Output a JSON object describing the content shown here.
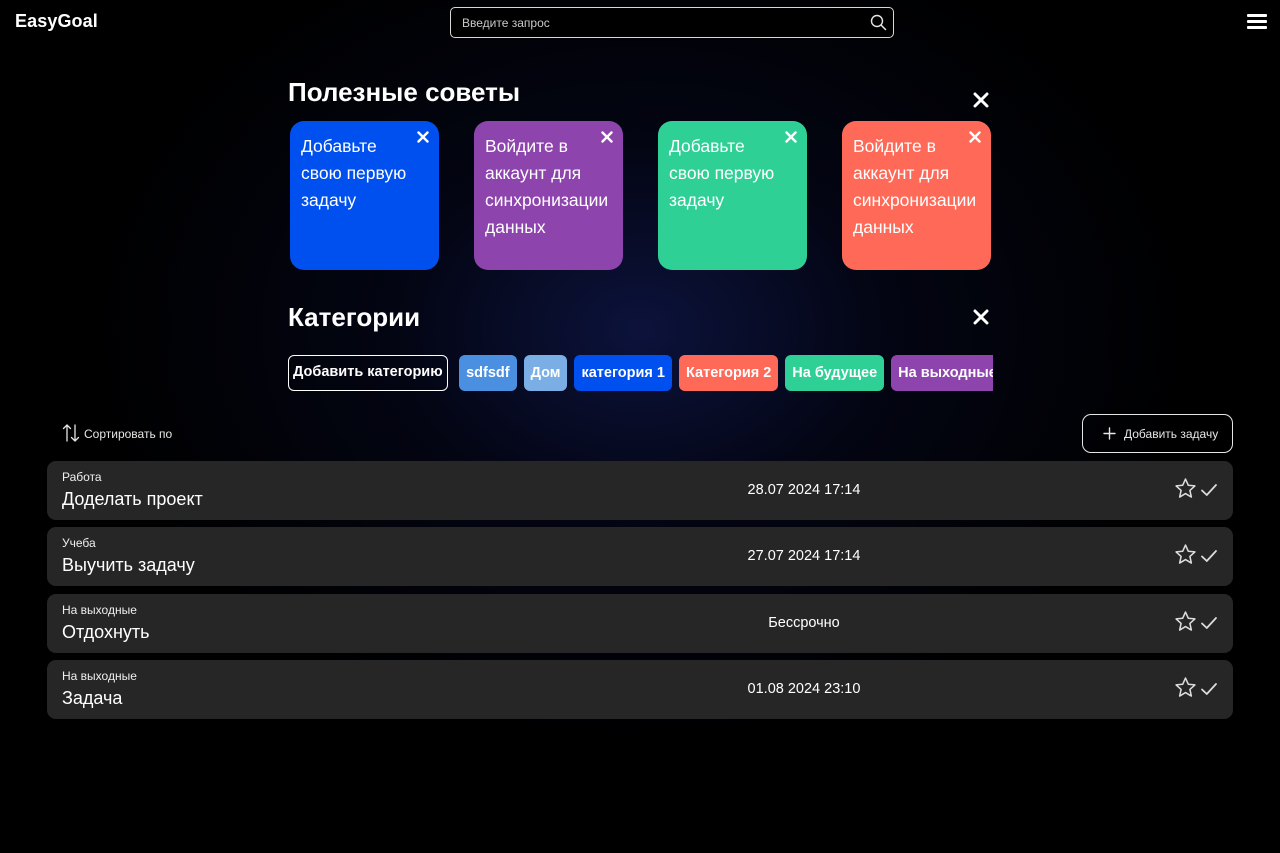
{
  "app": {
    "title": "EasyGoal"
  },
  "search": {
    "placeholder": "Введите запрос"
  },
  "tips": {
    "title": "Полезные советы",
    "cards": [
      {
        "text": "Добавьте свою первую задачу",
        "color": "#0050f0"
      },
      {
        "text": "Войдите в аккаунт для синхронизации данных",
        "color": "#8e44ad"
      },
      {
        "text": "Добавьте свою первую задачу",
        "color": "#2fd096"
      },
      {
        "text": "Войдите в аккаунт для синхронизации данных",
        "color": "#ff6a58"
      }
    ]
  },
  "categories": {
    "title": "Категории",
    "add_label": "Добавить категорию",
    "items": [
      {
        "label": "sdfsdf",
        "color": "#4a8fe0"
      },
      {
        "label": "Дом",
        "color": "#7aaee5"
      },
      {
        "label": "категория 1",
        "color": "#0050f0"
      },
      {
        "label": "Категория 2",
        "color": "#ff6a58"
      },
      {
        "label": "На будущее",
        "color": "#2fd096"
      },
      {
        "label": "На выходные",
        "color": "#8e44ad"
      }
    ]
  },
  "toolbar": {
    "sort_label": "Сортировать по",
    "add_task_label": "Добавить задачу"
  },
  "tasks": [
    {
      "category": "Работа",
      "title": "Доделать проект",
      "date": "28.07 2024 17:14"
    },
    {
      "category": "Учеба",
      "title": "Выучить задачу",
      "date": "27.07 2024 17:14"
    },
    {
      "category": "На выходные",
      "title": "Отдохнуть",
      "date": "Бессрочно"
    },
    {
      "category": "На выходные",
      "title": "Задача",
      "date": "01.08 2024 23:10"
    }
  ],
  "icons": {
    "search": "search-icon",
    "menu": "hamburger-menu-icon",
    "close": "close-icon",
    "sort": "sort-arrows-icon",
    "plus": "plus-icon",
    "star": "star-icon",
    "check": "checkmark-icon"
  }
}
